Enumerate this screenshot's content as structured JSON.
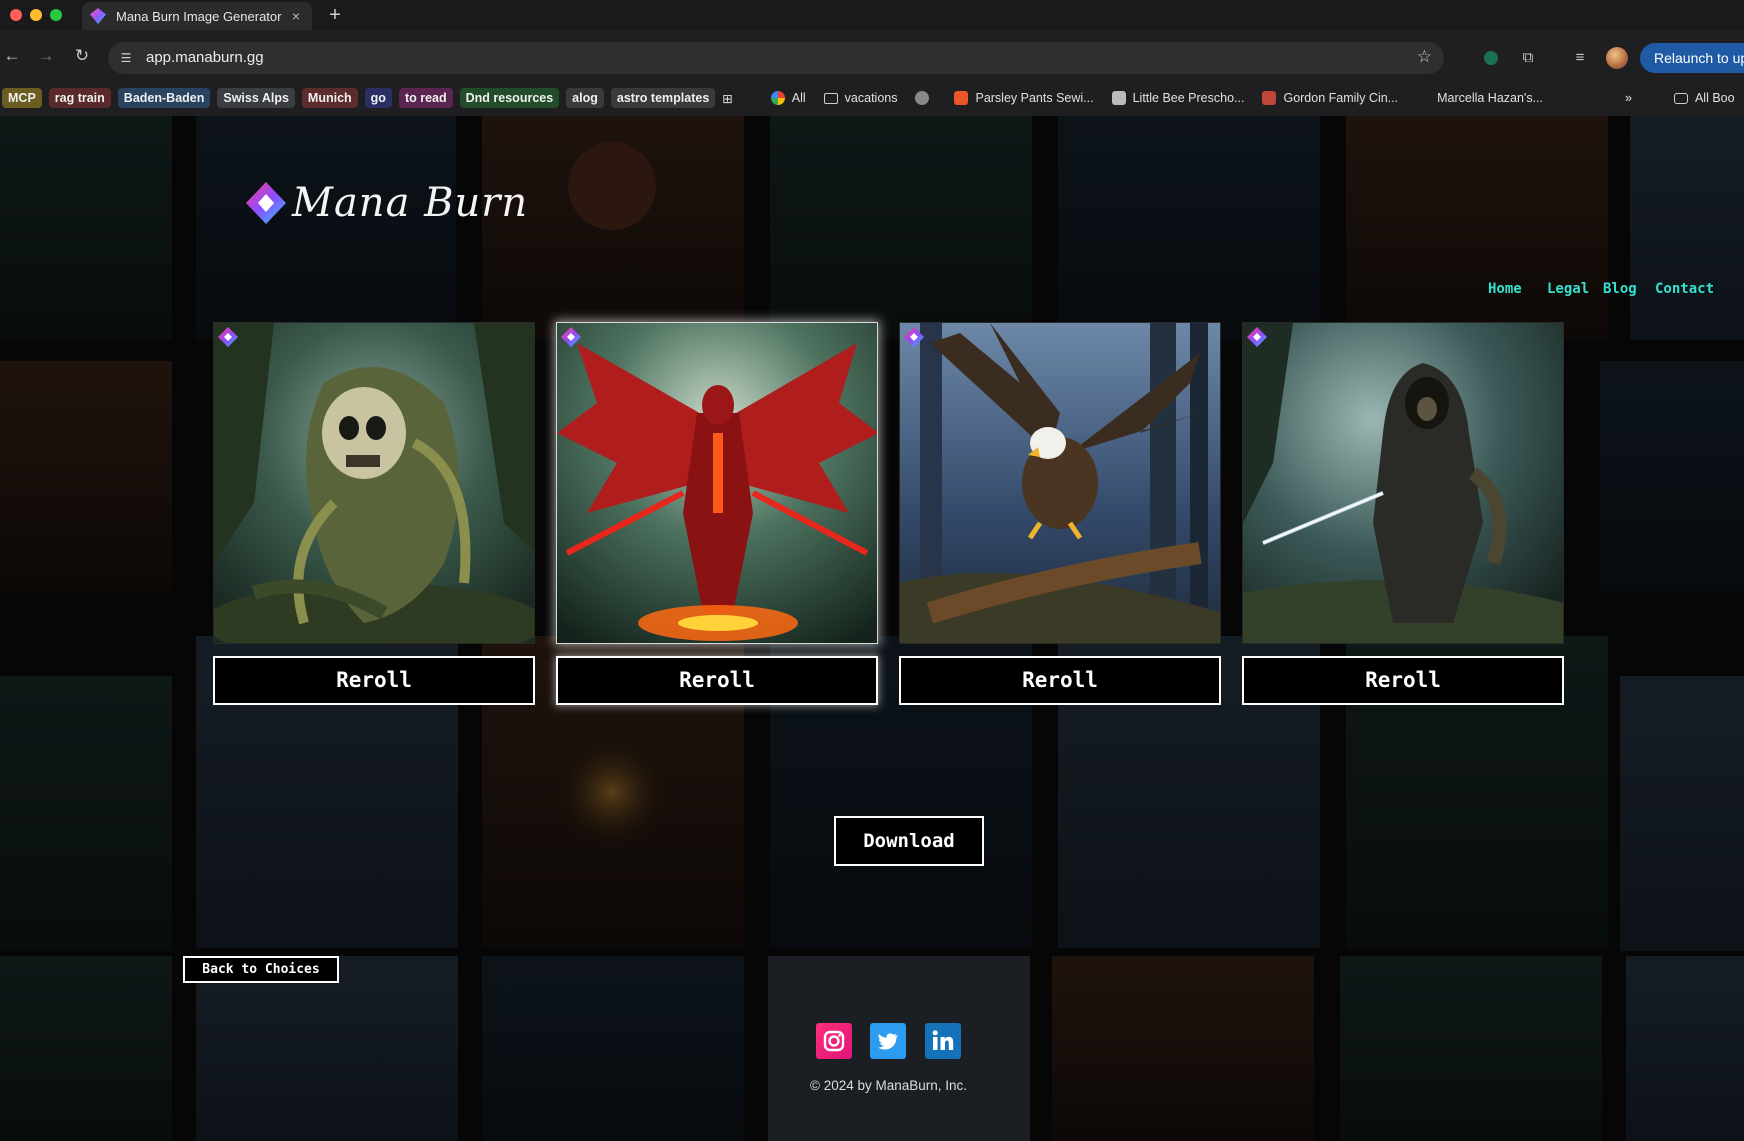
{
  "browser": {
    "tab_title": "Mana Burn Image Generator",
    "tab_close": "×",
    "new_tab": "+",
    "url": "app.manaburn.gg",
    "relaunch_label": "Relaunch to upd",
    "bookmarks": [
      {
        "label": "MCP",
        "style": "chip",
        "color": "#6b5c22"
      },
      {
        "label": "rag train",
        "style": "chip",
        "color": "#5a2a2a"
      },
      {
        "label": "Baden-Baden",
        "style": "chip",
        "color": "#2a4360"
      },
      {
        "label": "Swiss Alps",
        "style": "chip",
        "color": "#3a3d42"
      },
      {
        "label": "Munich",
        "style": "chip",
        "color": "#5c2b2b"
      },
      {
        "label": "go",
        "style": "chip",
        "color": "#2c2f66"
      },
      {
        "label": "to read",
        "style": "chip",
        "color": "#5c2450"
      },
      {
        "label": "Dnd resources",
        "style": "chip",
        "color": "#234d2a"
      },
      {
        "label": "alog",
        "style": "chip",
        "color": "#3a3a3c"
      },
      {
        "label": "astro templates",
        "style": "chip",
        "color": "#3a3a3c"
      },
      {
        "label": "All",
        "style": "link",
        "icon": "google-icon"
      },
      {
        "label": "vacations",
        "style": "link",
        "icon": "folder-icon"
      },
      {
        "label": "",
        "style": "link",
        "icon": "globe-icon"
      },
      {
        "label": "Parsley Pants Sewi...",
        "style": "link",
        "icon": "bookmark-icon"
      },
      {
        "label": "Little Bee Prescho...",
        "style": "link",
        "icon": "apple-icon"
      },
      {
        "label": "Gordon Family Cin...",
        "style": "link",
        "icon": "site-icon"
      },
      {
        "label": "Marcella Hazan's...",
        "style": "link",
        "icon": "blank-icon"
      }
    ],
    "more_label": "»",
    "all_bookmarks_label": "All Boo"
  },
  "site": {
    "logo_text": "Mana Burn",
    "nav": [
      "Home",
      "Legal",
      "Blog",
      "Contact"
    ],
    "cards": [
      {
        "subject": "swamp skull creature",
        "reroll_label": "Reroll",
        "selected": false
      },
      {
        "subject": "red winged demon",
        "reroll_label": "Reroll",
        "selected": true
      },
      {
        "subject": "bald eagle",
        "reroll_label": "Reroll",
        "selected": false
      },
      {
        "subject": "hooded warrior",
        "reroll_label": "Reroll",
        "selected": false
      }
    ],
    "download_label": "Download",
    "back_label": "Back to Choices",
    "copyright": "© 2024 by ManaBurn, Inc.",
    "socials": [
      "instagram-icon",
      "twitter-icon",
      "linkedin-icon"
    ]
  }
}
